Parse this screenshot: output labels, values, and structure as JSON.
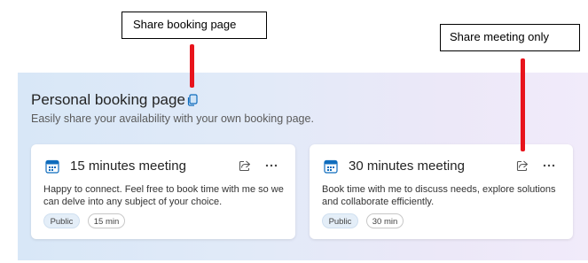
{
  "booking": {
    "title": "Personal booking page",
    "subtitle": "Easily share your availability with your own booking page."
  },
  "cards": [
    {
      "title": "15 minutes meeting",
      "description": "Happy to connect. Feel free to book time with me so we can delve into any subject of your choice.",
      "visibility": "Public",
      "duration": "15 min"
    },
    {
      "title": "30 minutes meeting",
      "description": "Book time with me to discuss needs, explore solutions and collaborate efficiently.",
      "visibility": "Public",
      "duration": "30 min"
    }
  ],
  "annotations": {
    "share_booking_page": "Share booking page",
    "share_meeting_only": "Share meeting only"
  },
  "colors": {
    "pointer": "#e8141c",
    "accent": "#0f6cbd"
  },
  "icons": {
    "copy": "copy-icon",
    "calendar": "calendar-icon",
    "share": "share-icon",
    "more": "more-icon"
  }
}
